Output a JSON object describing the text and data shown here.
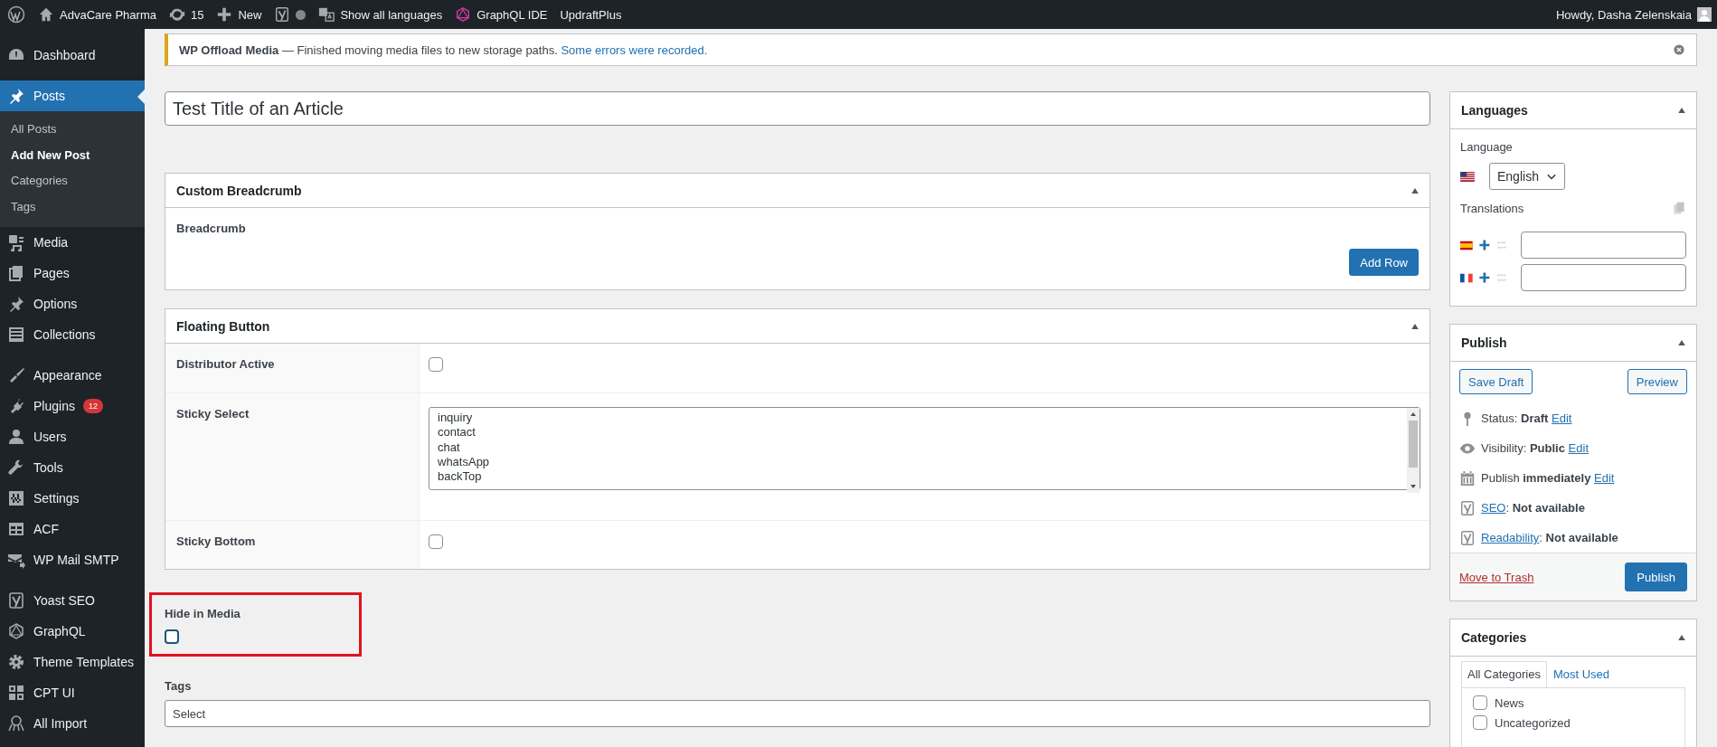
{
  "admin_bar": {
    "items": [
      {
        "label": "AdvaCare Pharma"
      },
      {
        "label": "15"
      },
      {
        "label": "New"
      },
      {
        "label": "Show all languages"
      },
      {
        "label": "GraphQL IDE"
      },
      {
        "label": "UpdraftPlus"
      }
    ],
    "account": "Howdy, Dasha Zelenskaia"
  },
  "sidebar": {
    "groups": [
      {
        "items": [
          {
            "label": "Dashboard",
            "selected": false
          }
        ]
      },
      {
        "items": [
          {
            "label": "Posts",
            "selected": true,
            "submenu": [
              {
                "label": "All Posts",
                "selected": false
              },
              {
                "label": "Add New Post",
                "selected": true
              },
              {
                "label": "Categories",
                "selected": false
              },
              {
                "label": "Tags",
                "selected": false
              }
            ]
          },
          {
            "label": "Media",
            "selected": false
          },
          {
            "label": "Pages",
            "selected": false
          },
          {
            "label": "Options",
            "selected": false
          },
          {
            "label": "Collections",
            "selected": false
          }
        ]
      },
      {
        "items": [
          {
            "label": "Appearance",
            "selected": false
          },
          {
            "label": "Plugins",
            "selected": false,
            "badge": "12"
          },
          {
            "label": "Users",
            "selected": false
          },
          {
            "label": "Tools",
            "selected": false
          },
          {
            "label": "Settings",
            "selected": false
          },
          {
            "label": "ACF",
            "selected": false
          },
          {
            "label": "WP Mail SMTP",
            "selected": false
          }
        ]
      },
      {
        "items": [
          {
            "label": "Yoast SEO",
            "selected": false
          },
          {
            "label": "GraphQL",
            "selected": false
          },
          {
            "label": "Theme Templates",
            "selected": false
          },
          {
            "label": "CPT UI",
            "selected": false
          },
          {
            "label": "All Import",
            "selected": false
          }
        ]
      }
    ]
  },
  "notice": {
    "message": "**WP Offload Media** — Finished moving media files to new storage paths.",
    "link": "Some errors were recorded."
  },
  "editor": {
    "title_field": {
      "value": "Test Title of an Article"
    },
    "boxes": [
      {
        "kind": "repeater",
        "title": "Custom Breadcrumb",
        "expanded": true,
        "field_label": "Breadcrumb",
        "button": "Add Row"
      },
      {
        "kind": "table",
        "title": "Floating Button",
        "expanded": true,
        "rows": [
          {
            "label": "Distributor Active",
            "kind": "checkbox",
            "checked": false
          },
          {
            "label": "Sticky Select",
            "kind": "listbox",
            "options": [
              {
                "label": "inquiry",
                "selected": false
              },
              {
                "label": "contact",
                "selected": false
              },
              {
                "label": "chat",
                "selected": false
              },
              {
                "label": "whatsApp",
                "selected": false
              },
              {
                "label": "backTop",
                "selected": false
              }
            ]
          },
          {
            "label": "Sticky Bottom",
            "kind": "checkbox",
            "checked": false
          }
        ]
      }
    ],
    "hide_in_media": {
      "label": "Hide in Media",
      "checked": false,
      "highlighted": true
    },
    "tags": {
      "label": "Tags",
      "placeholder": "Select"
    }
  },
  "side": {
    "languages": {
      "title": "Languages",
      "expanded": true,
      "language_label": "Language",
      "language": "English",
      "translations_label": "Translations",
      "translations": [
        {
          "kind": "es"
        },
        {
          "kind": "fr"
        }
      ]
    },
    "publish": {
      "title": "Publish",
      "expanded": true,
      "save_draft": "Save Draft",
      "preview": "Preview",
      "rows": [
        {
          "kind": "status",
          "text": "Status: **Draft**",
          "link": "Edit"
        },
        {
          "kind": "status",
          "text": "Visibility: **Public**",
          "link": "Edit"
        },
        {
          "kind": "status",
          "text": "Publish **immediately**",
          "link": "Edit"
        },
        {
          "kind": "score",
          "link": "SEO",
          "text": ": **Not available**"
        },
        {
          "kind": "score",
          "link": "Readability",
          "text": ": **Not available**"
        }
      ],
      "trash": "Move to Trash",
      "publish": "Publish"
    },
    "categories": {
      "title": "Categories",
      "expanded": true,
      "tabs": [
        {
          "label": "All Categories",
          "selected": true
        },
        {
          "label": "Most Used",
          "selected": false
        }
      ],
      "items": [
        {
          "label": "News",
          "checked": false
        },
        {
          "label": "Uncategorized",
          "checked": false
        }
      ]
    }
  }
}
